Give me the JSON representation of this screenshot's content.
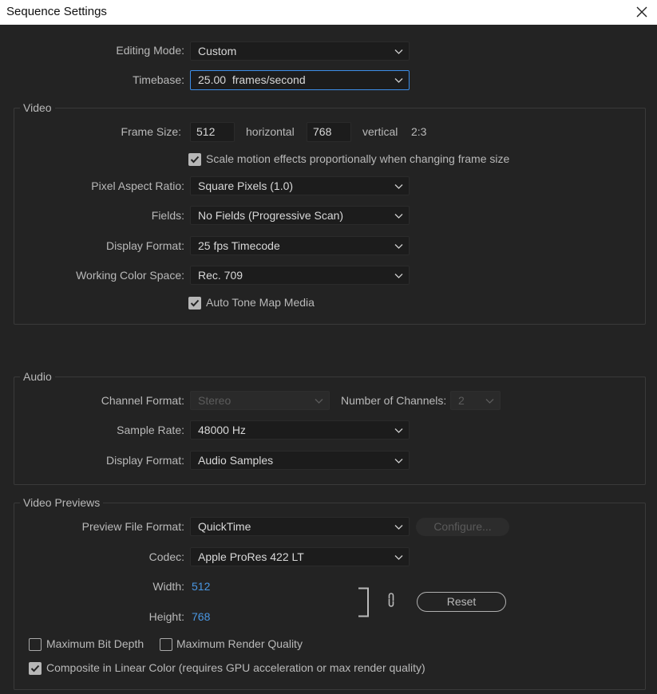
{
  "window": {
    "title": "Sequence Settings"
  },
  "general": {
    "editing_mode_label": "Editing Mode:",
    "editing_mode_value": "Custom",
    "timebase_label": "Timebase:",
    "timebase_value": "25.00  frames/second"
  },
  "video": {
    "title": "Video",
    "frame_size_label": "Frame Size:",
    "width_value": "512",
    "horizontal_label": "horizontal",
    "height_value": "768",
    "vertical_label": "vertical",
    "aspect": "2:3",
    "scale_motion_label": "Scale motion effects proportionally when changing frame size",
    "scale_motion_checked": true,
    "pixel_aspect_label": "Pixel Aspect Ratio:",
    "pixel_aspect_value": "Square Pixels (1.0)",
    "fields_label": "Fields:",
    "fields_value": "No Fields (Progressive Scan)",
    "display_format_label": "Display Format:",
    "display_format_value": "25 fps Timecode",
    "color_space_label": "Working Color Space:",
    "color_space_value": "Rec. 709",
    "tone_map_label": "Auto Tone Map Media",
    "tone_map_checked": true
  },
  "audio": {
    "title": "Audio",
    "channel_format_label": "Channel Format:",
    "channel_format_value": "Stereo",
    "num_channels_label": "Number of Channels:",
    "num_channels_value": "2",
    "sample_rate_label": "Sample Rate:",
    "sample_rate_value": "48000 Hz",
    "display_format_label": "Display Format:",
    "display_format_value": "Audio Samples"
  },
  "previews": {
    "title": "Video Previews",
    "file_format_label": "Preview File Format:",
    "file_format_value": "QuickTime",
    "configure_label": "Configure...",
    "codec_label": "Codec:",
    "codec_value": "Apple ProRes 422 LT",
    "width_label": "Width:",
    "width_value": "512",
    "height_label": "Height:",
    "height_value": "768",
    "reset_label": "Reset",
    "max_bit_depth_label": "Maximum Bit Depth",
    "max_bit_depth_checked": false,
    "max_render_quality_label": "Maximum Render Quality",
    "max_render_quality_checked": false,
    "linear_color_label": "Composite in Linear Color (requires GPU acceleration or max render quality)",
    "linear_color_checked": true
  },
  "icons": {
    "chevron": "chevron-down-icon",
    "check": "checkmark-icon",
    "link": "link-icon",
    "close": "close-icon"
  },
  "colors": {
    "background": "#232323",
    "accent": "#3d8ee8",
    "link_value": "#4a97e3"
  }
}
